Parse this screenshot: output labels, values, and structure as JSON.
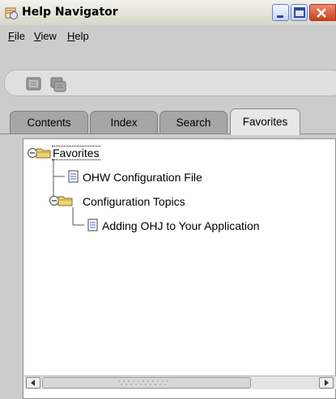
{
  "window": {
    "title": "Help Navigator"
  },
  "menubar": {
    "items": [
      {
        "label": "File",
        "mnemonic": "F",
        "rest": "ile"
      },
      {
        "label": "View",
        "mnemonic": "V",
        "rest": "iew"
      },
      {
        "label": "Help",
        "mnemonic": "H",
        "rest": "elp"
      }
    ]
  },
  "tabs": [
    {
      "label": "Contents",
      "selected": false
    },
    {
      "label": "Index",
      "selected": false
    },
    {
      "label": "Search",
      "selected": false
    },
    {
      "label": "Favorites",
      "selected": true
    }
  ],
  "tree": [
    {
      "label": "Favorites",
      "type": "folder",
      "expanded": true,
      "level": 0
    },
    {
      "label": "OHW Configuration File",
      "type": "document",
      "level": 1
    },
    {
      "label": "Configuration Topics",
      "type": "folder",
      "expanded": true,
      "level": 1
    },
    {
      "label": "Adding OHJ to Your Application",
      "type": "document",
      "level": 2
    }
  ],
  "colors": {
    "window_bg": "#cccccc",
    "folder": "#e8d37a",
    "doc_lines": "#3a5fcd",
    "close_button": "#d4502c"
  },
  "icons": [
    "help-app-icon",
    "minimize-icon",
    "maximize-icon",
    "close-icon",
    "view-icon",
    "print-icon",
    "collapse-icon",
    "folder-icon",
    "document-icon",
    "scroll-left-icon",
    "scroll-right-icon"
  ]
}
